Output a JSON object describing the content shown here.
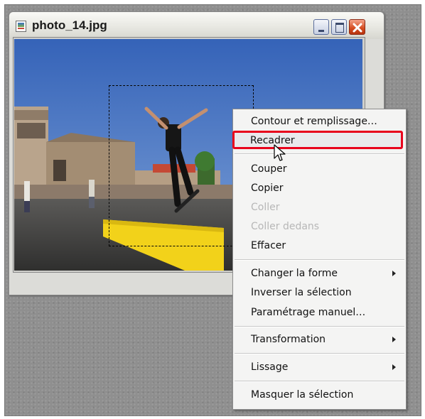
{
  "window": {
    "title": "photo_14.jpg",
    "icon": "image-file-icon",
    "controls": [
      "minimize-icon",
      "maximize-icon",
      "close-icon"
    ]
  },
  "context_menu": {
    "items": [
      {
        "label": "Contour et remplissage…",
        "enabled": true
      },
      {
        "label": "Recadrer",
        "enabled": true,
        "hovered": true
      },
      {
        "label": "Couper",
        "enabled": true
      },
      {
        "label": "Copier",
        "enabled": true
      },
      {
        "label": "Coller",
        "enabled": false
      },
      {
        "label": "Coller dedans",
        "enabled": false
      },
      {
        "label": "Effacer",
        "enabled": true
      },
      {
        "label": "Changer la forme",
        "enabled": true,
        "submenu": true
      },
      {
        "label": "Inverser la sélection",
        "enabled": true
      },
      {
        "label": "Paramétrage manuel…",
        "enabled": true
      },
      {
        "label": "Transformation",
        "enabled": true,
        "submenu": true
      },
      {
        "label": "Lissage",
        "enabled": true,
        "submenu": true
      },
      {
        "label": "Masquer la sélection",
        "enabled": true
      }
    ]
  },
  "colors": {
    "highlight_border": "#e8001c",
    "sky": "#3f6fc0",
    "ramp_yellow": "#f2d21a"
  }
}
